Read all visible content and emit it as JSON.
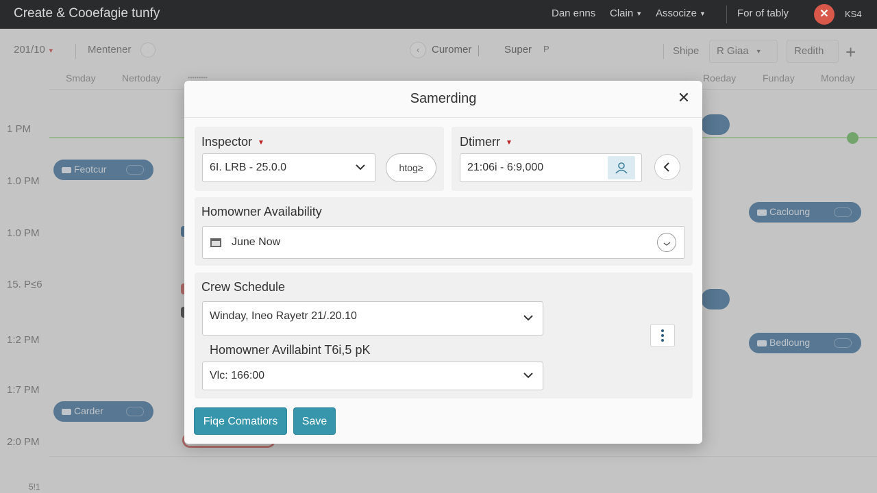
{
  "app": {
    "title": "Create & Cooefagie tunfy"
  },
  "topnav": {
    "items": [
      {
        "label": "Dan enns",
        "has_caret": false
      },
      {
        "label": "Clain",
        "has_caret": true
      },
      {
        "label": "Associze",
        "has_caret": true
      },
      {
        "label": "For of tably",
        "has_caret": false
      }
    ],
    "user_code": "KS4",
    "avatar_glyph": "✕"
  },
  "calendar": {
    "date_selector": "201/10",
    "view_label": "Mentener",
    "nav_left": "Curomer",
    "nav_right": "Super",
    "nav_right_icon": "P",
    "shipe_label": "Shipe",
    "filter_label": "R Giaa",
    "refresh_label": "Redith",
    "add_glyph": "+",
    "day_headers": [
      "Smday",
      "Nertoday",
      "Roeday",
      "Funday",
      "Monday"
    ],
    "time_labels": [
      "1 PM",
      "1.0 PM",
      "1.0 PM",
      "15. P≤6",
      "1:2 PM",
      "1:7 PM",
      "2:0 PM",
      "5!1"
    ],
    "events": [
      "Feotcur",
      "Cacloung",
      "Bedloung",
      "Carder"
    ]
  },
  "modal": {
    "title": "Samerding",
    "close_glyph": "✕",
    "inspector": {
      "label": "Inspector",
      "value": "6I. LRB - 25.0.0",
      "action_label": "htog≥"
    },
    "dtimerr": {
      "label": "Dtimerr",
      "value": "21:06i - 6:9,000"
    },
    "availability": {
      "label": "Homowner Availability",
      "value": "June Now"
    },
    "crew": {
      "label": "Crew Schedule",
      "schedule_value": "Winday,  Ineo Rayetr 21/.20.10",
      "sub_label": "Homowner Avillabint T6i,5 pK",
      "sub_value": "Vlc: 166:00"
    },
    "buttons": {
      "primary": "Fiqe Comatiors",
      "save": "Save"
    }
  },
  "colors": {
    "accent": "#3796ac",
    "event": "#245d8e",
    "topbar": "#2a2b2d",
    "now_line": "#9ed28b",
    "required": "#b22222"
  }
}
